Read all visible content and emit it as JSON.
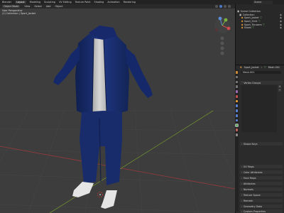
{
  "topbar": {
    "app_menu": "Blender",
    "tabs": [
      "Layout",
      "Modeling",
      "Sculpting",
      "UV Editing",
      "Texture Paint",
      "Shading",
      "Animation",
      "Rendering"
    ],
    "scene": "Scene"
  },
  "viewport": {
    "mode": "Object Mode",
    "view_label": "User Perspective",
    "collection_label": "(1) Collection | Sport_Jacket",
    "menu": [
      "View",
      "Select",
      "Add",
      "Object"
    ]
  },
  "outliner": {
    "title": "Scene Collection",
    "items": [
      {
        "label": "Scene Collection",
        "indent": 0
      },
      {
        "label": "Collection",
        "indent": 1
      },
      {
        "label": "Sport_Jacket",
        "indent": 2
      },
      {
        "label": "Sport_Shirt",
        "indent": 2
      },
      {
        "label": "Sport_Trousers",
        "indent": 2
      },
      {
        "label": "Shoes",
        "indent": 2
      }
    ]
  },
  "properties": {
    "object_name": "Sport_Jacket",
    "data_name": "Mesh.001",
    "panels": [
      "Vertex Groups",
      "Shape Keys",
      "UV Maps",
      "Color Attributes",
      "Face Maps",
      "Attributes",
      "Normals",
      "Texture Space",
      "Remesh",
      "Geometry Data",
      "Custom Properties"
    ]
  },
  "colors": {
    "viewport_bg": "#3d3d3d",
    "panel_bg": "#2b2b2b",
    "accent_blue": "#4a7ac7",
    "outfit_navy": "#1a2f6e",
    "shirt_grey": "#c9c9c9",
    "object_orange": "#e09a38",
    "mesh_green": "#6fb86f"
  }
}
